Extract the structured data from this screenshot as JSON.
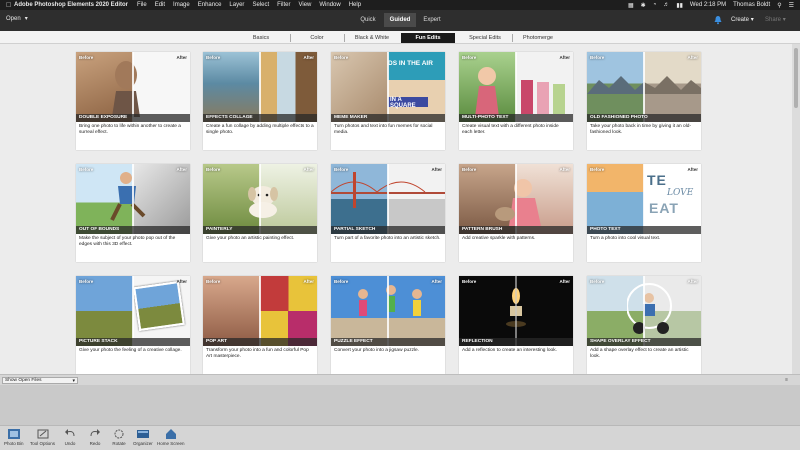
{
  "menubar": {
    "app_name": "Adobe Photoshop Elements 2020 Editor",
    "menus": [
      "File",
      "Edit",
      "Image",
      "Enhance",
      "Layer",
      "Select",
      "Filter",
      "View",
      "Window",
      "Help"
    ],
    "datetime": "Wed 2:18 PM",
    "user": "Thomas Boldt"
  },
  "toolbar": {
    "open_label": "Open",
    "modes": [
      "Quick",
      "Guided",
      "Expert"
    ],
    "active_mode": "Guided",
    "create_label": "Create",
    "share_label": "Share"
  },
  "subtabs": {
    "items": [
      "Basics",
      "Color",
      "Black & White",
      "Fun Edits",
      "Special Edits",
      "Photomerge"
    ],
    "active": "Fun Edits"
  },
  "labels": {
    "before": "Before",
    "after": "After"
  },
  "cards": [
    {
      "title": "DOUBLE EXPOSURE",
      "desc": "Bring one photo to life within another to create a surreal effect."
    },
    {
      "title": "EFFECTS COLLAGE",
      "desc": "Create a fun collage by adding multiple effects to a single photo."
    },
    {
      "title": "MEME MAKER",
      "desc": "Turn photos and text into fun memes for social media.",
      "overlay1": "DS IN THE AIR",
      "overlay2": "IN A SQUARE"
    },
    {
      "title": "MULTI-PHOTO TEXT",
      "desc": "Create visual text with a different photo inside each letter."
    },
    {
      "title": "OLD FASHIONED PHOTO",
      "desc": "Take your photo back in time by giving it an old-fashioned look."
    },
    {
      "title": "OUT OF BOUNDS",
      "desc": "Make the subject of your photo pop out of the edges with this 3D effect."
    },
    {
      "title": "PAINTERLY",
      "desc": "Give your photo an artistic painting effect."
    },
    {
      "title": "PARTIAL SKETCH",
      "desc": "Turn part of a favorite photo into an artistic sketch."
    },
    {
      "title": "PATTERN BRUSH",
      "desc": "Add creative sparkle with patterns."
    },
    {
      "title": "PHOTO TEXT",
      "desc": "Turn a photo into cool visual text.",
      "overlay1": "TE",
      "overlay2": "LOVE",
      "overlay3": "EAT"
    },
    {
      "title": "PICTURE STACK",
      "desc": "Give your photo the feeling of a creative collage."
    },
    {
      "title": "POP ART",
      "desc": "Transform your photo into a fun and colorful Pop Art masterpiece."
    },
    {
      "title": "PUZZLE EFFECT",
      "desc": "Convert your photo into a jigsaw puzzle."
    },
    {
      "title": "REFLECTION",
      "desc": "Add a reflection to create an interesting look."
    },
    {
      "title": "SHAPE OVERLAY EFFECT",
      "desc": "Add a shape overlay effect to create an artistic look."
    }
  ],
  "bin": {
    "selector_label": "Show Open Files"
  },
  "bottom_tools": [
    "Photo Bin",
    "Tool Options",
    "Undo",
    "Redo",
    "Rotate",
    "Organizer",
    "Home Screen"
  ]
}
